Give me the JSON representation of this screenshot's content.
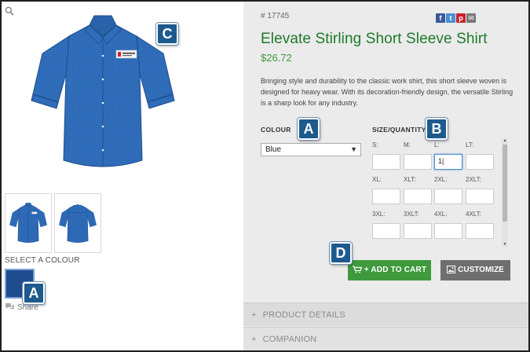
{
  "product": {
    "sku": "# 17745",
    "title": "Elevate Stirling Short Sleeve Shirt",
    "price": "$26.72",
    "description": "Bringing style and durability to the classic work shirt, this short sleeve woven is designed for heavy wear. With its decoration-friendly design, the versatile Stirling is a sharp look for any industry.",
    "shirt_color": "#2d69b5",
    "shirt_dark": "#1f4f8e"
  },
  "social": [
    {
      "icon": "facebook-icon",
      "glyph": "f",
      "color": "#3b5998"
    },
    {
      "icon": "twitter-icon",
      "glyph": "t",
      "color": "#4a8fd4"
    },
    {
      "icon": "pinterest-icon",
      "glyph": "p",
      "color": "#c8232c"
    },
    {
      "icon": "email-icon",
      "glyph": "✉",
      "color": "#777777"
    }
  ],
  "colour": {
    "label": "COLOUR",
    "selected": "Blue"
  },
  "size_quantity": {
    "label": "SIZE/QUANTITY",
    "sizes": [
      {
        "label": "S:",
        "value": ""
      },
      {
        "label": "M:",
        "value": ""
      },
      {
        "label": "L:",
        "value": "1|"
      },
      {
        "label": "LT:",
        "value": ""
      },
      {
        "label": "XL:",
        "value": ""
      },
      {
        "label": "XLT:",
        "value": ""
      },
      {
        "label": "2XL:",
        "value": ""
      },
      {
        "label": "2XLT:",
        "value": ""
      },
      {
        "label": "3XL:",
        "value": ""
      },
      {
        "label": "3XLT:",
        "value": ""
      },
      {
        "label": "4XL:",
        "value": ""
      },
      {
        "label": "4XLT:",
        "value": ""
      }
    ]
  },
  "buttons": {
    "add_to_cart": "+ ADD TO CART",
    "customize": "CUSTOMIZE",
    "cart_color": "#3e9a3c",
    "customize_color": "#6f6f6f"
  },
  "left": {
    "select_colour_label": "SELECT A COLOUR",
    "swatch_color": "#1e4c8f",
    "share_label": "Share"
  },
  "accordion": [
    {
      "label": "PRODUCT DETAILS"
    },
    {
      "label": "COMPANION"
    }
  ],
  "badges": {
    "left_swatch": "A",
    "colour": "A",
    "size": "B",
    "image": "C",
    "cart": "D",
    "color": "#1d5a8e"
  }
}
